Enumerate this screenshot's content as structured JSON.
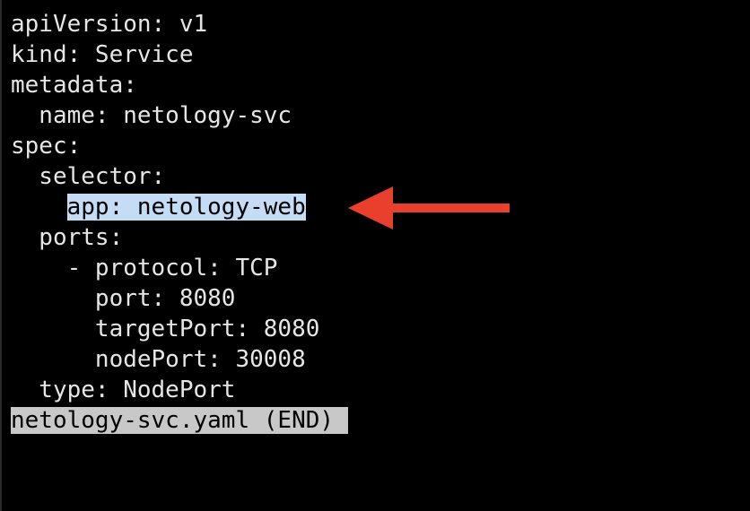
{
  "file": {
    "lines": [
      "apiVersion: v1",
      "kind: Service",
      "metadata:",
      "  name: netology-svc",
      "spec:",
      "  selector:",
      "    app: netology-web",
      "  ports:",
      "    - protocol: TCP",
      "      port: 8080",
      "      targetPort: 8080",
      "      nodePort: 30008",
      "  type: NodePort"
    ],
    "highlighted_text": "app: netology-web",
    "highlight_indent": "    "
  },
  "pager": {
    "status": "netology-svc.yaml (END)"
  },
  "annotation": {
    "icon": "left-arrow-icon",
    "color": "#e8402c"
  },
  "colors": {
    "background": "#000000",
    "text": "#e6e6e6",
    "selection": "#c5dcf5",
    "status_bar": "#c8c8c8"
  }
}
